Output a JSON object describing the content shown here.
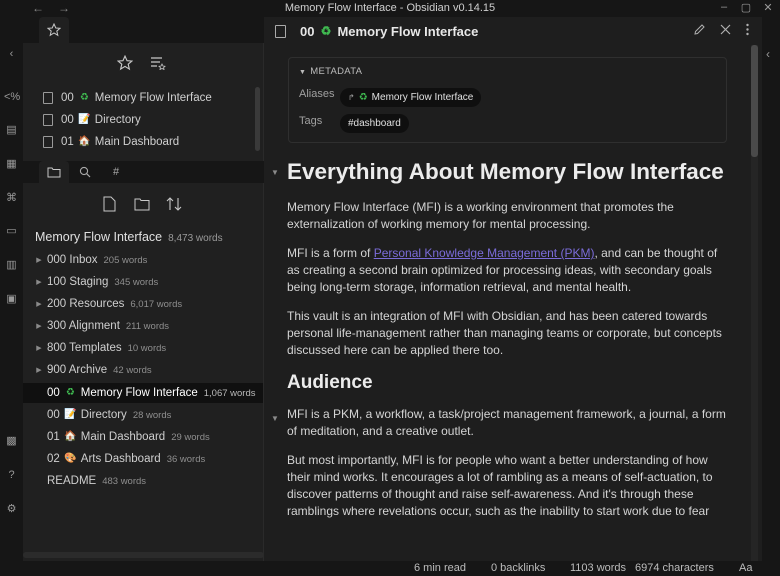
{
  "window": {
    "title": "Memory Flow Interface - Obsidian v0.14.15",
    "controls": [
      "–",
      "▢",
      "✕"
    ]
  },
  "ribbon": {
    "icons": [
      "collapse-chevron-icon",
      "code-icon",
      "table-icon",
      "sheet-icon",
      "graph-icon",
      "cards-icon",
      "kanban-icon",
      "calendar-icon",
      "vault-icon",
      "help-icon",
      "settings-icon"
    ]
  },
  "bookmarks": {
    "items": [
      {
        "prefix": "00",
        "emoji": "♻",
        "label": "Memory Flow Interface"
      },
      {
        "prefix": "00",
        "emoji": "📝",
        "label": "Directory"
      },
      {
        "prefix": "01",
        "emoji": "🏠",
        "label": "Main Dashboard"
      }
    ]
  },
  "file_explorer": {
    "vault_name": "Memory Flow Interface",
    "vault_words": "8,473 words",
    "folders": [
      {
        "label": "000 Inbox",
        "words": "205 words"
      },
      {
        "label": "100 Staging",
        "words": "345 words"
      },
      {
        "label": "200 Resources",
        "words": "6,017 words"
      },
      {
        "label": "300 Alignment",
        "words": "211 words"
      },
      {
        "label": "800 Templates",
        "words": "10 words"
      },
      {
        "label": "900 Archive",
        "words": "42 words"
      }
    ],
    "files": [
      {
        "prefix": "00",
        "emoji": "♻",
        "label": "Memory Flow Interface",
        "words": "1,067 words",
        "active": true
      },
      {
        "prefix": "00",
        "emoji": "📝",
        "label": "Directory",
        "words": "28 words"
      },
      {
        "prefix": "01",
        "emoji": "🏠",
        "label": "Main Dashboard",
        "words": "29 words"
      },
      {
        "prefix": "02",
        "emoji": "🎨",
        "label": "Arts Dashboard",
        "words": "36 words"
      },
      {
        "prefix": "",
        "emoji": "",
        "label": "README",
        "words": "483 words"
      }
    ]
  },
  "editor": {
    "title_prefix": "00",
    "title_emoji": "♻",
    "title": "Memory Flow Interface",
    "metadata": {
      "heading": "METADATA",
      "aliases_label": "Aliases",
      "alias_value": "Memory Flow Interface",
      "alias_emoji": "♻",
      "tags_label": "Tags",
      "tag_value": "#dashboard"
    },
    "h1": "Everything About Memory Flow Interface",
    "p1": "Memory Flow Interface (MFI) is a working environment that promotes the externalization of working memory for mental processing.",
    "p2_before": "MFI is a form of ",
    "p2_link": "Personal Knowledge Management (PKM)",
    "p2_after": ", and can be thought of as creating a second brain optimized for processing ideas, with secondary goals being long-term storage, information retrieval, and mental health.",
    "p3": "This vault is an integration of MFI with Obsidian, and has been catered towards personal life-management rather than managing teams or corporate, but concepts discussed here can be applied there too.",
    "h2": "Audience",
    "p4": "MFI is a PKM, a workflow, a task/project management framework, a journal, a form of meditation, and a creative outlet.",
    "p5": "But most importantly, MFI is for people who want a better understanding of how their mind works. It encourages a lot of rambling as a means of self-actuation, to discover patterns of thought and raise self-awareness. And it's through these ramblings where revelations occur, such as the inability to start work due to fear"
  },
  "status": {
    "read_time": "6 min read",
    "backlinks": "0 backlinks",
    "words": "1103 words",
    "characters": "6974 characters",
    "aa": "Aa"
  },
  "colors": {
    "accent": "#7b6cd9",
    "recycle": "#3fb950"
  }
}
